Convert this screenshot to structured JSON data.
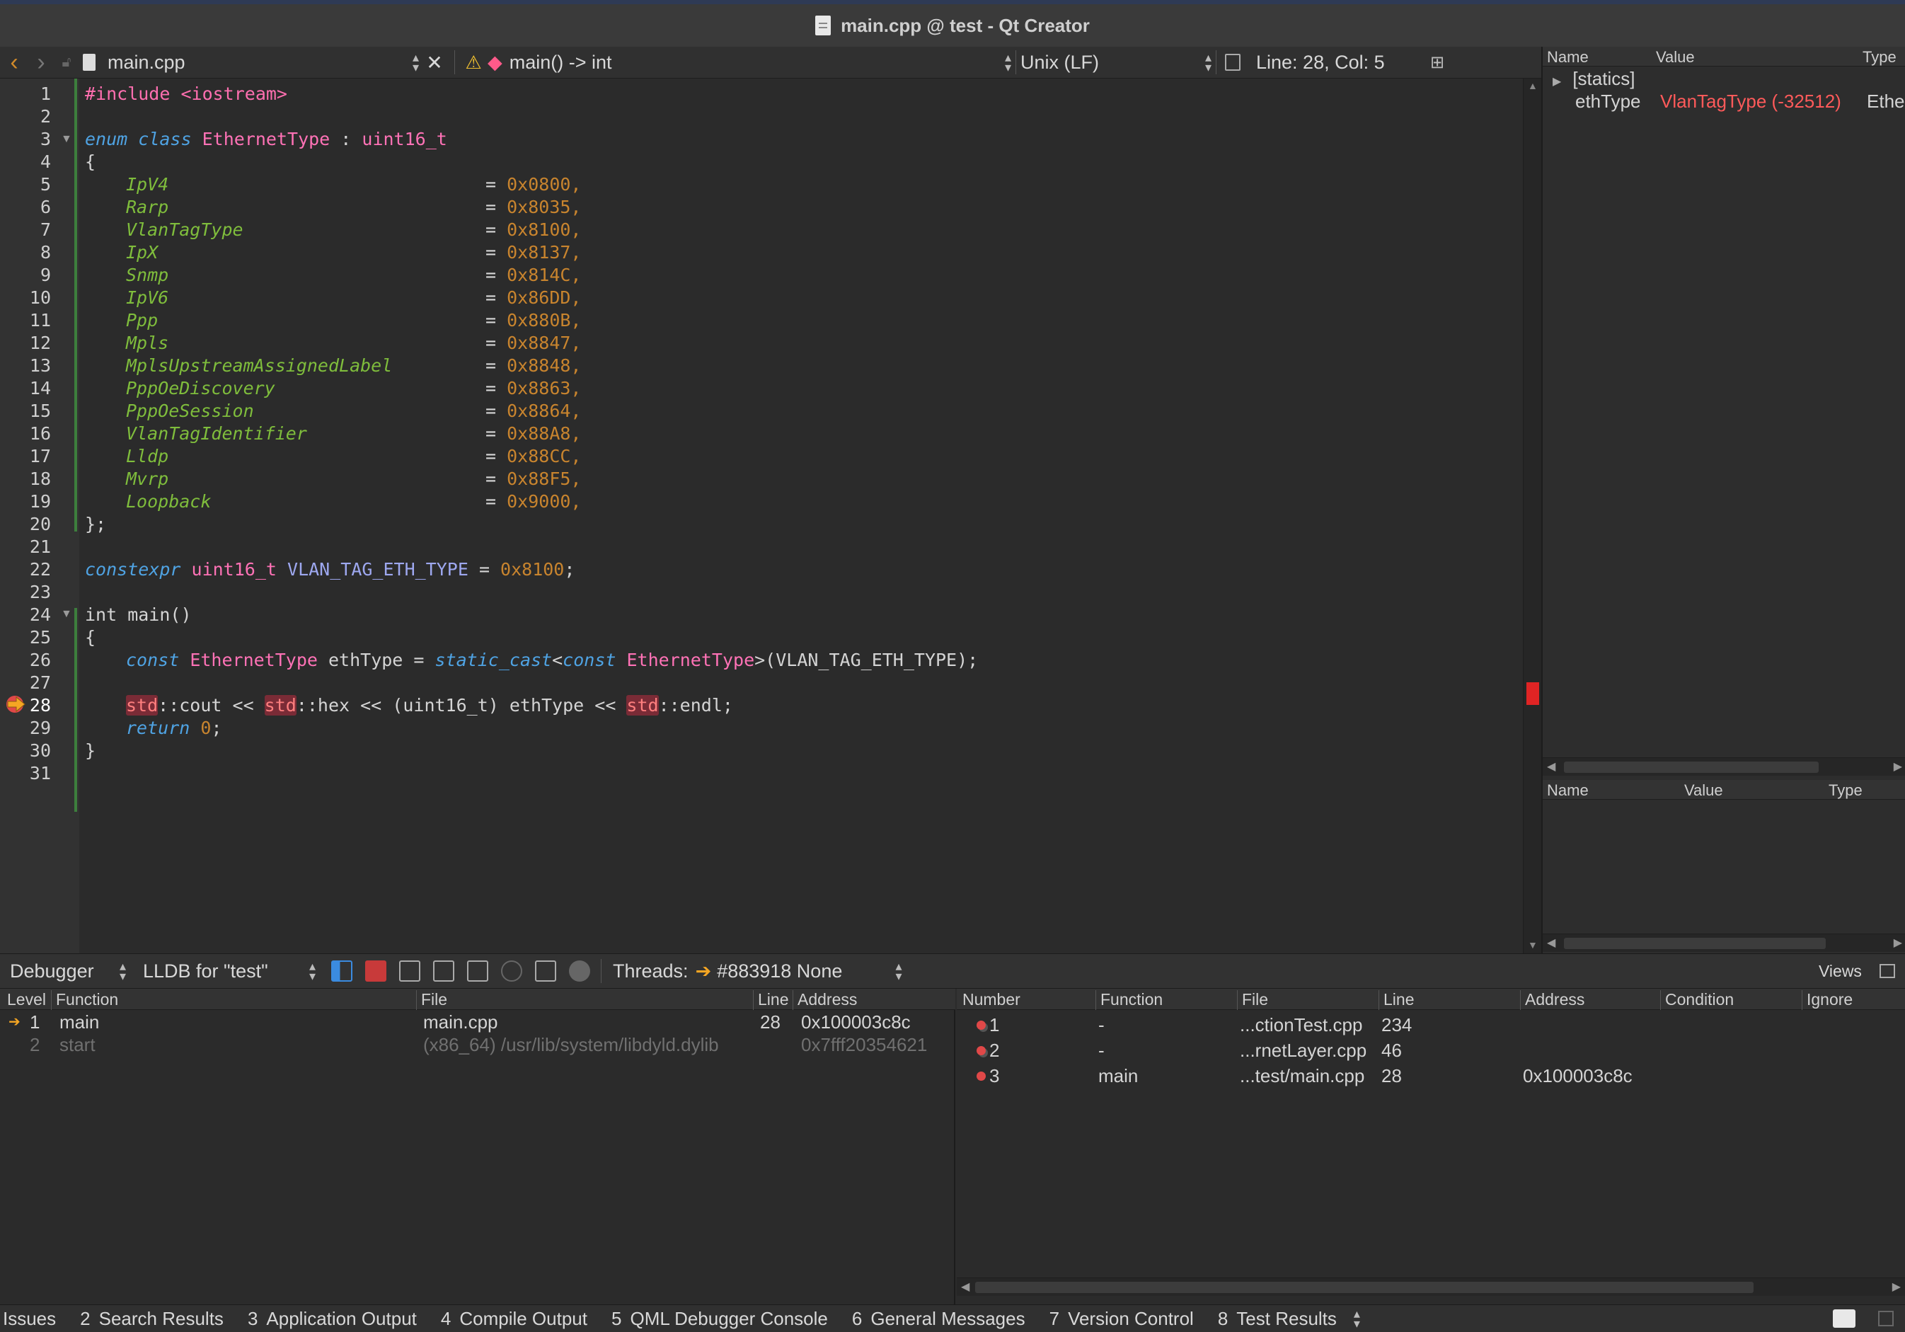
{
  "window": {
    "title": "main.cpp @ test - Qt Creator"
  },
  "editor_toolbar": {
    "file_name": "main.cpp",
    "function_scope": "main() -> int",
    "line_ending": "Unix (LF)",
    "cursor_position": "Line: 28, Col: 5"
  },
  "code": {
    "line_numbers": [
      "1",
      "2",
      "3",
      "4",
      "5",
      "6",
      "7",
      "8",
      "9",
      "10",
      "11",
      "12",
      "13",
      "14",
      "15",
      "16",
      "17",
      "18",
      "19",
      "20",
      "21",
      "22",
      "23",
      "24",
      "25",
      "26",
      "27",
      "28",
      "29",
      "30",
      "31"
    ],
    "include": "#include <iostream>",
    "enum_decl": {
      "kw1": "enum",
      "kw2": "class",
      "name": "EthernetType",
      "sep": " : ",
      "base": "uint16_t"
    },
    "brace_open": "{",
    "enumerators": [
      {
        "name": "IpV4",
        "value": "0x0800,"
      },
      {
        "name": "Rarp",
        "value": "0x8035,"
      },
      {
        "name": "VlanTagType",
        "value": "0x8100,"
      },
      {
        "name": "IpX",
        "value": "0x8137,"
      },
      {
        "name": "Snmp",
        "value": "0x814C,"
      },
      {
        "name": "IpV6",
        "value": "0x86DD,"
      },
      {
        "name": "Ppp",
        "value": "0x880B,"
      },
      {
        "name": "Mpls",
        "value": "0x8847,"
      },
      {
        "name": "MplsUpstreamAssignedLabel",
        "value": "0x8848,"
      },
      {
        "name": "PppOeDiscovery",
        "value": "0x8863,"
      },
      {
        "name": "PppOeSession",
        "value": "0x8864,"
      },
      {
        "name": "VlanTagIdentifier",
        "value": "0x88A8,"
      },
      {
        "name": "Lldp",
        "value": "0x88CC,"
      },
      {
        "name": "Mvrp",
        "value": "0x88F5,"
      },
      {
        "name": "Loopback",
        "value": "0x9000,"
      }
    ],
    "enum_close": "};",
    "constexpr_line": {
      "kw": "constexpr",
      "type": "uint16_t",
      "name": "VLAN_TAG_ETH_TYPE",
      "eq": " = ",
      "value": "0x8100",
      "end": ";"
    },
    "main_sig": "int main()",
    "brace_open2": "{",
    "line26": {
      "kw": "const",
      "type": "EthernetType",
      "var": " ethType = ",
      "cast": "static_cast",
      "lt": "<",
      "kw2": "const",
      "type2": "EthernetType",
      "rest": ">(VLAN_TAG_ETH_TYPE);"
    },
    "line28": {
      "std1": "std",
      "p1": "::cout << ",
      "std2": "std",
      "p2": "::hex << (uint16_t) ethType << ",
      "std3": "std",
      "p3": "::endl;"
    },
    "line29": {
      "kw": "return",
      "value": "0",
      "end": ";"
    },
    "brace_close": "}"
  },
  "locals_panel": {
    "headers": [
      "Name",
      "Value",
      "Type"
    ],
    "rows": [
      {
        "name": "[statics]",
        "value": "",
        "type": ""
      },
      {
        "name": "ethType",
        "value": "VlanTagType (-32512)",
        "type": "Ether"
      }
    ]
  },
  "expressions_panel": {
    "headers": [
      "Name",
      "Value",
      "Type"
    ]
  },
  "debugger_toolbar": {
    "mode": "Debugger",
    "engine": "LLDB for \"test\"",
    "threads_label": "Threads:",
    "thread_value": "#883918 None",
    "views_label": "Views"
  },
  "stack": {
    "headers": [
      "Level",
      "Function",
      "File",
      "Line",
      "Address"
    ],
    "rows": [
      {
        "level": "1",
        "function": "main",
        "file": "main.cpp",
        "line": "28",
        "address": "0x100003c8c"
      },
      {
        "level": "2",
        "function": "start",
        "file": "(x86_64) /usr/lib/system/libdyld.dylib",
        "line": "",
        "address": "0x7fff20354621"
      }
    ]
  },
  "breakpoints": {
    "headers": [
      "Number",
      "Function",
      "File",
      "Line",
      "Address",
      "Condition",
      "Ignore"
    ],
    "rows": [
      {
        "number": "1",
        "function": "-",
        "file": "...ctionTest.cpp",
        "line": "234",
        "address": ""
      },
      {
        "number": "2",
        "function": "-",
        "file": "...rnetLayer.cpp",
        "line": "46",
        "address": ""
      },
      {
        "number": "3",
        "function": "main",
        "file": "...test/main.cpp",
        "line": "28",
        "address": "0x100003c8c"
      }
    ]
  },
  "output_tabs": [
    {
      "num": "",
      "label": "Issues"
    },
    {
      "num": "2",
      "label": "Search Results"
    },
    {
      "num": "3",
      "label": "Application Output"
    },
    {
      "num": "4",
      "label": "Compile Output"
    },
    {
      "num": "5",
      "label": "QML Debugger Console"
    },
    {
      "num": "6",
      "label": "General Messages"
    },
    {
      "num": "7",
      "label": "Version Control"
    },
    {
      "num": "8",
      "label": "Test Results"
    }
  ],
  "colors": {
    "breakpoint_red": "#e04848",
    "execution_arrow": "#f5a623",
    "accent_pink": "#ff6fb0"
  }
}
